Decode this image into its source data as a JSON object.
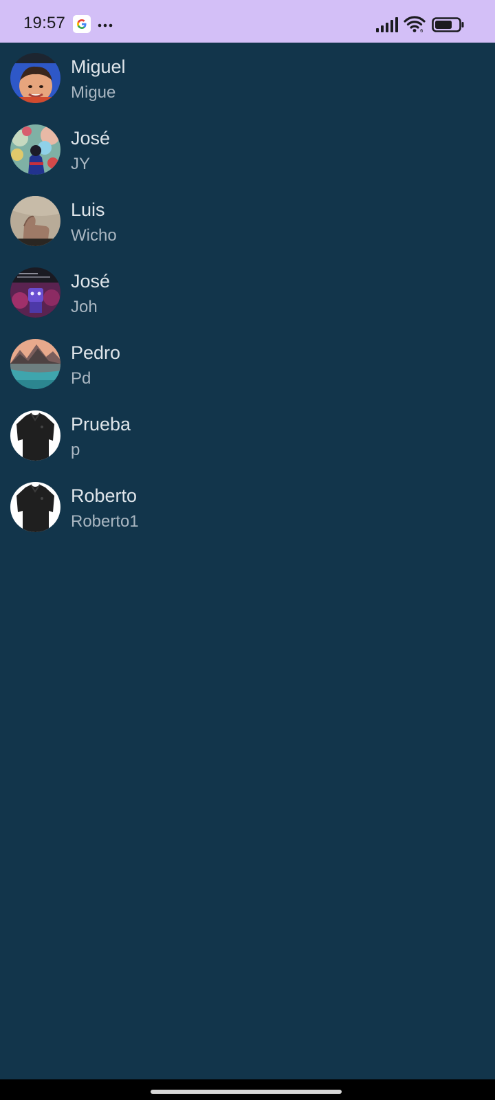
{
  "status_bar": {
    "time": "19:57",
    "background": "#d3bff7"
  },
  "contacts": [
    {
      "name": "Miguel",
      "username": "Migue"
    },
    {
      "name": "José",
      "username": "JY"
    },
    {
      "name": "Luis",
      "username": "Wicho"
    },
    {
      "name": "José",
      "username": "Joh"
    },
    {
      "name": "Pedro",
      "username": "Pd"
    },
    {
      "name": "Prueba",
      "username": "p"
    },
    {
      "name": "Roberto",
      "username": "Roberto1"
    }
  ],
  "theme": {
    "background": "#12354b",
    "name_color": "#dfe5ea",
    "username_color": "#aab7c2"
  }
}
